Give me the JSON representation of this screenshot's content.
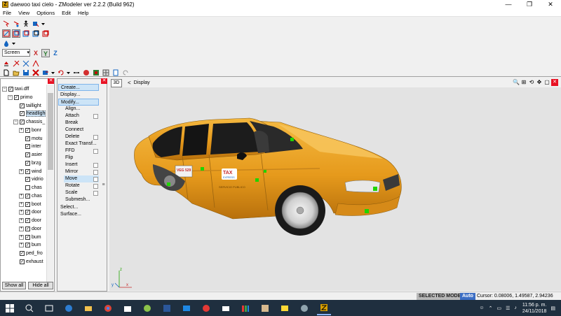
{
  "window": {
    "icon_letter": "Z",
    "title": "daewoo taxi cielo - ZModeler ver 2.2.2 (Build 962)",
    "minimize_glyph": "—",
    "maximize_glyph": "❐",
    "close_glyph": "✕"
  },
  "menu": [
    "File",
    "View",
    "Options",
    "Edit",
    "Help"
  ],
  "toolbar": {
    "coord_select": "Screen",
    "axis_x": "X",
    "axis_y": "Y",
    "axis_z": "Z",
    "axis_x_color": "#c62828",
    "axis_y_color": "#2e7d32",
    "axis_z_color": "#1565c0"
  },
  "tree": {
    "close_glyph": "✕",
    "nodes": [
      {
        "label": "taxi.dff",
        "checked": true,
        "expander": "−",
        "level": 0
      },
      {
        "label": "primo",
        "checked": true,
        "expander": "−",
        "level": 1
      },
      {
        "label": "taillight",
        "checked": true,
        "expander": "",
        "level": 2
      },
      {
        "label": "headligh",
        "checked": true,
        "expander": "",
        "level": 2,
        "selected": true
      },
      {
        "label": "chassis_",
        "checked": true,
        "expander": "−",
        "level": 2
      },
      {
        "label": "bonr",
        "checked": true,
        "expander": "+",
        "level": 3
      },
      {
        "label": "motu",
        "checked": true,
        "expander": "",
        "level": 3
      },
      {
        "label": "inter",
        "checked": true,
        "expander": "",
        "level": 3
      },
      {
        "label": "asier",
        "checked": true,
        "expander": "",
        "level": 3
      },
      {
        "label": "brzg",
        "checked": true,
        "expander": "",
        "level": 3
      },
      {
        "label": "wind",
        "checked": true,
        "expander": "+",
        "level": 3
      },
      {
        "label": "vidrio",
        "checked": true,
        "expander": "",
        "level": 3
      },
      {
        "label": "chas",
        "checked": false,
        "expander": "",
        "level": 3
      },
      {
        "label": "chas",
        "checked": true,
        "expander": "+",
        "level": 3
      },
      {
        "label": "boot",
        "checked": true,
        "expander": "+",
        "level": 3
      },
      {
        "label": "door",
        "checked": true,
        "expander": "+",
        "level": 3
      },
      {
        "label": "door",
        "checked": true,
        "expander": "+",
        "level": 3
      },
      {
        "label": "door",
        "checked": true,
        "expander": "+",
        "level": 3
      },
      {
        "label": "bum",
        "checked": true,
        "expander": "+",
        "level": 3
      },
      {
        "label": "bum",
        "checked": true,
        "expander": "+",
        "level": 3
      },
      {
        "label": "ped_fro",
        "checked": true,
        "expander": "",
        "level": 2
      },
      {
        "label": "exhaust",
        "checked": true,
        "expander": "",
        "level": 2
      }
    ],
    "show_all": "Show all",
    "hide_all": "Hide all"
  },
  "commands": {
    "close_glyph": "✕",
    "top": [
      {
        "label": "Create...",
        "highlight": true
      },
      {
        "label": "Display...",
        "highlight": false
      },
      {
        "label": "Modify...",
        "highlight": true
      }
    ],
    "modify_items": [
      {
        "label": "Align...",
        "options": false
      },
      {
        "label": "Attach",
        "options": true
      },
      {
        "label": "Break",
        "options": false
      },
      {
        "label": "Connect",
        "options": false
      },
      {
        "label": "Delete",
        "options": true
      },
      {
        "label": "Exact Transf...",
        "options": false
      },
      {
        "label": "FFD",
        "options": true
      },
      {
        "label": "Flip",
        "options": false
      },
      {
        "label": "Insert",
        "options": true
      },
      {
        "label": "Mirror",
        "options": true
      },
      {
        "label": "Move",
        "options": true,
        "active": true
      },
      {
        "label": "Rotate",
        "options": true
      },
      {
        "label": "Scale",
        "options": true
      },
      {
        "label": "Submesh...",
        "options": false
      }
    ],
    "bottom": [
      "Select...",
      "Surface..."
    ]
  },
  "viewport": {
    "mode_label": "3D",
    "back_glyph": "<",
    "title": "Display",
    "body_color": "#e8a020",
    "plate_text": "VEG 529",
    "taxi_text": "TAX",
    "brand_text": "EXPRESS",
    "service_text": "SERVICIO PUBLICO",
    "axis_x": "x",
    "axis_y": "y",
    "axis_z": "z"
  },
  "status": {
    "mode": "SELECTED MODE",
    "auto": "Auto",
    "cursor": "Cursor: 0.08006, 1.49587, 2.94236"
  },
  "taskbar": {
    "time": "11:56 p. m.",
    "date": "24/11/2018"
  }
}
